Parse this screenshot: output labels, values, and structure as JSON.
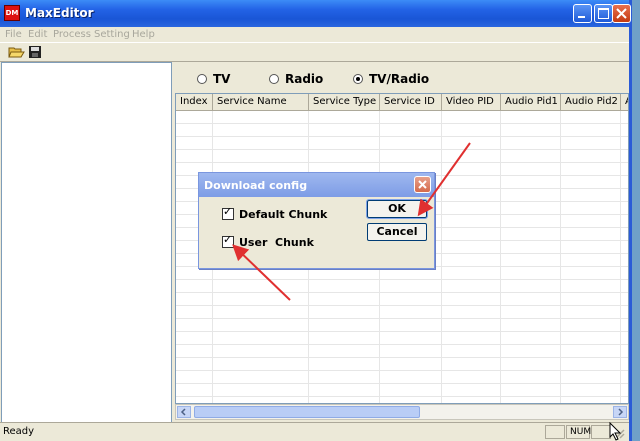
{
  "window": {
    "title": "MaxEditor",
    "app_icon_text": "DM",
    "caption_buttons": [
      "minimize-icon",
      "maximize-icon",
      "close-icon"
    ]
  },
  "menu": [
    "File",
    "Edit",
    "Process",
    "Setting",
    "Help"
  ],
  "toolbar": {
    "buttons": [
      "open-folder-icon",
      "save-disk-icon"
    ]
  },
  "mode": {
    "options": [
      "TV",
      "Radio",
      "TV/Radio"
    ],
    "selected": "TV/Radio"
  },
  "grid": {
    "columns": [
      "Index",
      "Service Name",
      "Service Type",
      "Service ID",
      "Video PID",
      "Audio Pid1",
      "Audio Pid2",
      "A"
    ],
    "rows": []
  },
  "dialog": {
    "title": "Download config",
    "checkboxes": [
      {
        "label": "Default Chunk",
        "checked": true
      },
      {
        "label": "User  Chunk",
        "checked": true
      }
    ],
    "ok_label": "OK",
    "cancel_label": "Cancel"
  },
  "status": {
    "text": "Ready",
    "num_indicator": "NUM"
  },
  "colors": {
    "titlebar": "#2363e6",
    "dialog_titlebar": "#7d9ce6",
    "annotation_arrow": "#e03030"
  }
}
